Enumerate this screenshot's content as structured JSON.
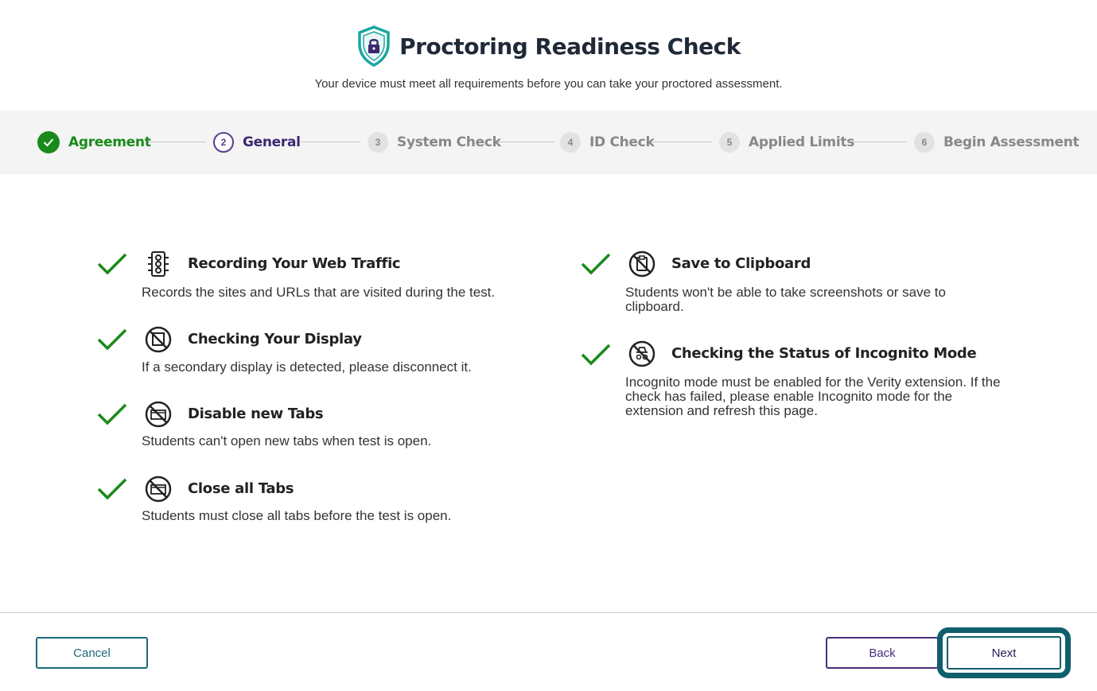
{
  "header": {
    "title": "Proctoring Readiness Check",
    "subtitle": "Your device must meet all requirements before you can take your proctored assessment."
  },
  "steps": [
    {
      "number": "✓",
      "label": "Agreement",
      "state": "done"
    },
    {
      "number": "2",
      "label": "General",
      "state": "active"
    },
    {
      "number": "3",
      "label": "System Check",
      "state": "pending"
    },
    {
      "number": "4",
      "label": "ID Check",
      "state": "pending"
    },
    {
      "number": "5",
      "label": "Applied Limits",
      "state": "pending"
    },
    {
      "number": "6",
      "label": "Begin Assessment",
      "state": "pending"
    }
  ],
  "features": [
    {
      "title": "Recording Your Web Traffic",
      "description": "Records the sites and URLs that are visited during the test.",
      "icon": "traffic-light-icon",
      "passed": true
    },
    {
      "title": "Checking Your Display",
      "description": "If a secondary display is detected, please disconnect it.",
      "icon": "no-display-icon",
      "passed": true
    },
    {
      "title": "Disable new Tabs",
      "description": "Students can't open new tabs when test is open.",
      "icon": "no-tabs-icon",
      "passed": true
    },
    {
      "title": "Close all Tabs",
      "description": "Students must close all tabs before the test is open.",
      "icon": "close-tabs-icon",
      "passed": true
    },
    {
      "title": "Save to Clipboard",
      "description": "Students won't be able to take screenshots or save to clipboard.",
      "icon": "no-clipboard-icon",
      "passed": true
    },
    {
      "title": "Checking the Status of Incognito Mode",
      "description": "Incognito mode must be enabled for the Verity extension. If the check has failed, please enable Incognito mode for the extension and refresh this page.",
      "icon": "no-incognito-icon",
      "passed": true
    }
  ],
  "footer": {
    "cancel_label": "Cancel",
    "back_label": "Back",
    "next_label": "Next"
  },
  "colors": {
    "success": "#1a8a1a",
    "active_step": "#3c2770",
    "teal": "#0f5f6e",
    "purple": "#4a2e7a"
  }
}
